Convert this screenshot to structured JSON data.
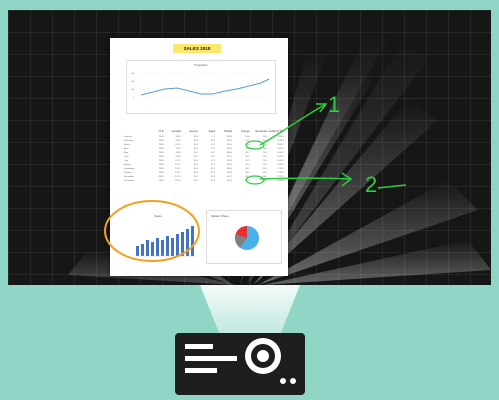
{
  "document": {
    "title": "SALES 2018",
    "line_chart_title": "Projection",
    "bar_chart_title": "Sales",
    "pie_chart_title": "Market Share",
    "table_headers": [
      "",
      "Cl.B",
      "Canada",
      "Europe",
      "Sales",
      "Bukalo",
      "Orange",
      "Remanda",
      "Garden(YTD)"
    ],
    "months": [
      "January",
      "February",
      "March",
      "April",
      "May",
      "June",
      "July",
      "August",
      "September",
      "October",
      "November",
      "December"
    ]
  },
  "annotations": {
    "label_1": "1",
    "label_2": "2",
    "color": "#2ecc40",
    "circle_color": "#f0a020"
  },
  "colors": {
    "background": "#8fd6c6",
    "screen": "#161616",
    "projector": "#1e1e1e",
    "bar": "#4472c4",
    "line": "#5b9bd5",
    "pie": [
      "#4ab0e8",
      "#e83030",
      "#808080"
    ]
  },
  "icons": [
    "projector-icon"
  ]
}
